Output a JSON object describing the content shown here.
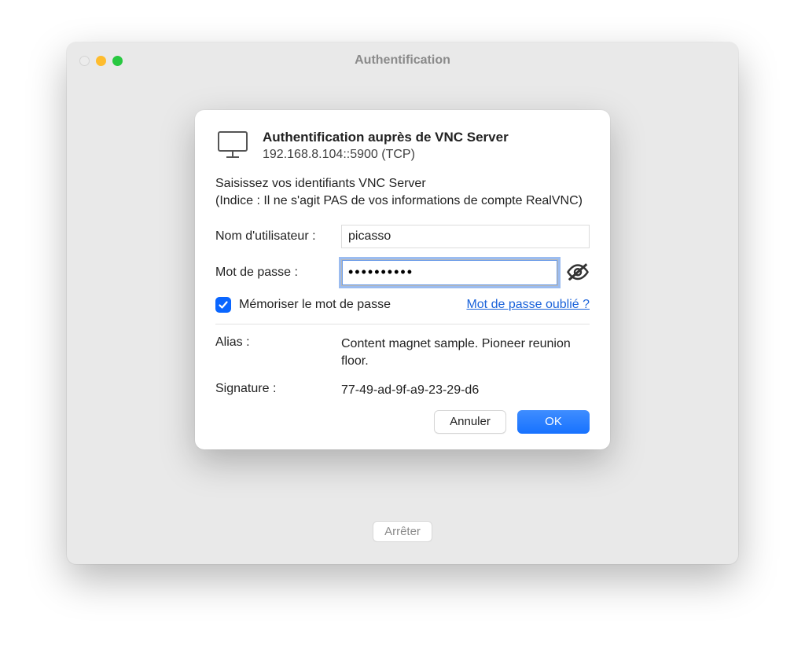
{
  "window": {
    "title": "Authentification",
    "stop_label": "Arrêter"
  },
  "dialog": {
    "header_title": "Authentification auprès de VNC Server",
    "header_sub": "192.168.8.104::5900 (TCP)",
    "instructions": "Saisissez vos identifiants VNC Server\n(Indice : Il ne s'agit PAS de vos informations de compte RealVNC)",
    "username_label": "Nom d'utilisateur :",
    "username_value": "picasso",
    "password_label": "Mot de passe :",
    "password_value": "••••••••••",
    "remember_label": "Mémoriser le mot de passe",
    "forgot_label": "Mot de passe oublié ?",
    "alias_label": "Alias :",
    "alias_value": "Content magnet sample. Pioneer reunion floor.",
    "signature_label": "Signature :",
    "signature_value": "77-49-ad-9f-a9-23-29-d6",
    "cancel_label": "Annuler",
    "ok_label": "OK"
  }
}
